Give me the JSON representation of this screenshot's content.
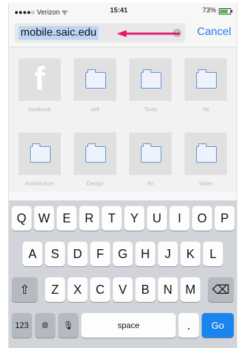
{
  "status_bar": {
    "carrier": "●●●●○ Verizon ᯤ",
    "time": "15:41",
    "battery": "73%"
  },
  "url_bar": {
    "value": "mobile.saic.edu",
    "cancel_label": "Cancel"
  },
  "annotation": {
    "color": "#e6136b"
  },
  "favorites": [
    {
      "label": "facebook",
      "icon": "facebook-icon"
    },
    {
      "label": "self",
      "icon": "folder-icon"
    },
    {
      "label": "Tools",
      "icon": "folder-icon"
    },
    {
      "label": "All",
      "icon": "folder-icon"
    },
    {
      "label": "Architecture",
      "icon": "folder-icon"
    },
    {
      "label": "Design",
      "icon": "folder-icon"
    },
    {
      "label": "Art",
      "icon": "folder-icon"
    },
    {
      "label": "Video",
      "icon": "folder-icon"
    }
  ],
  "keyboard": {
    "row1": [
      "Q",
      "W",
      "E",
      "R",
      "T",
      "Y",
      "U",
      "I",
      "O",
      "P"
    ],
    "row2": [
      "A",
      "S",
      "D",
      "F",
      "G",
      "H",
      "J",
      "K",
      "L"
    ],
    "row3": [
      "Z",
      "X",
      "C",
      "V",
      "B",
      "N",
      "M"
    ],
    "shift": "⇧",
    "delete": "⌫",
    "numbers": "123",
    "globe": "🌐︎",
    "mic": "🎙︎",
    "space": "space",
    "dot": ".",
    "go": "Go"
  }
}
